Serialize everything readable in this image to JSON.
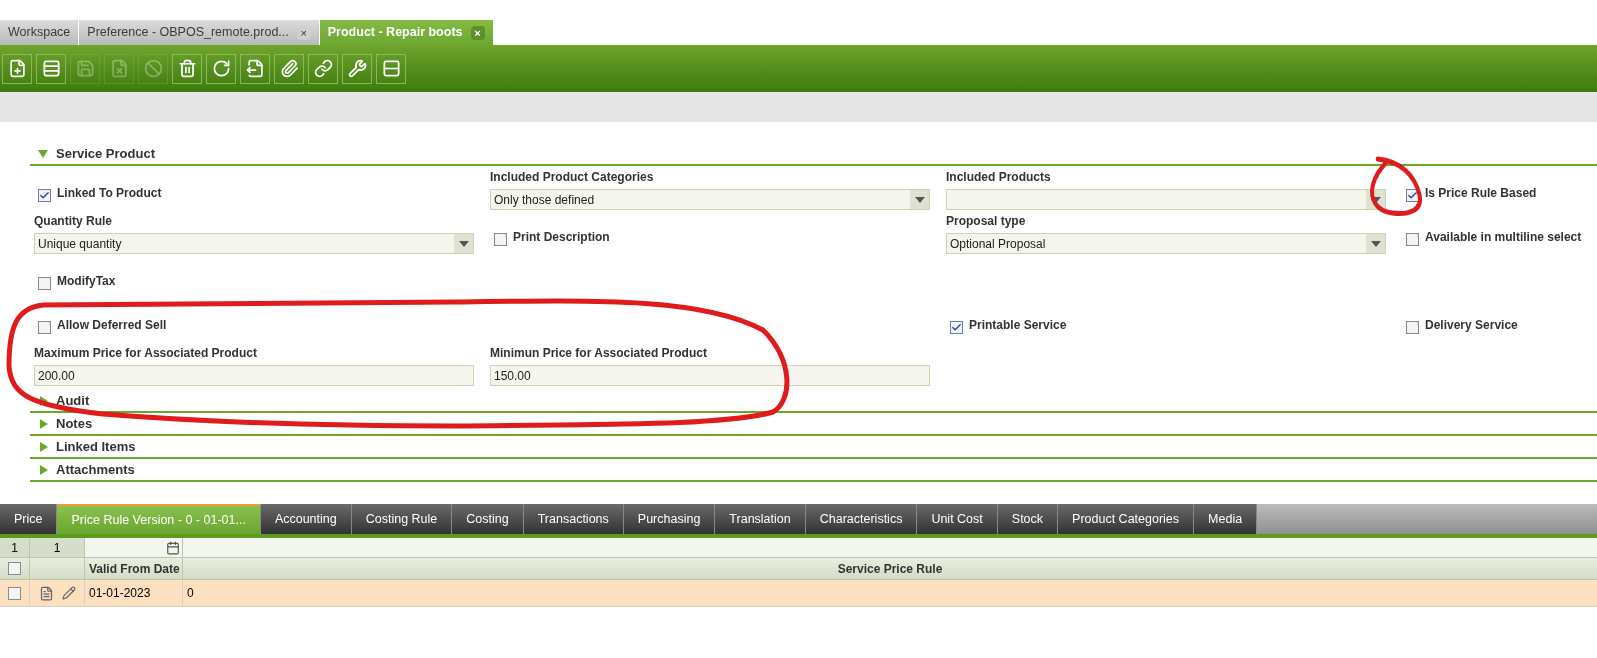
{
  "doc_tabs": [
    {
      "label": "Workspace",
      "selected": false,
      "closable": false
    },
    {
      "label": "Preference - OBPOS_remote.prod...",
      "selected": false,
      "closable": true
    },
    {
      "label": "Product - Repair boots",
      "selected": true,
      "closable": true
    }
  ],
  "close_glyph": "×",
  "toolbar": [
    {
      "kind": "new",
      "disabled": false
    },
    {
      "kind": "new_grid",
      "disabled": false
    },
    {
      "kind": "save",
      "disabled": true
    },
    {
      "kind": "save_close",
      "disabled": true
    },
    {
      "kind": "cancel",
      "disabled": true
    },
    {
      "kind": "delete",
      "disabled": false
    },
    {
      "kind": "refresh",
      "disabled": false
    },
    {
      "kind": "export",
      "disabled": false
    },
    {
      "kind": "attach",
      "disabled": false
    },
    {
      "kind": "link",
      "disabled": false
    },
    {
      "kind": "tools",
      "disabled": false
    },
    {
      "kind": "layout",
      "disabled": false
    }
  ],
  "section": {
    "title": "Service Product",
    "expanded": true,
    "rows": [
      [
        {
          "kind": "checkbox",
          "label": "Linked To Product",
          "checked": true
        },
        {
          "kind": "select",
          "label": "Included Product Categories",
          "value": "Only those defined"
        },
        {
          "kind": "select",
          "label": "Included Products"
        },
        {
          "kind": "checkbox",
          "label": "Is Price Rule Based",
          "checked": true
        }
      ],
      [
        {
          "kind": "select",
          "label": "Quantity Rule",
          "value": "Unique quantity"
        },
        {
          "kind": "checkbox",
          "label": "Print Description",
          "checked": false
        },
        {
          "kind": "select",
          "label": "Proposal type",
          "value": "Optional Proposal"
        },
        {
          "kind": "checkbox",
          "label": "Available in multiline select",
          "checked": false
        }
      ],
      [
        {
          "kind": "checkbox",
          "label": "ModifyTax",
          "checked": false
        },
        {
          "kind": "blank"
        },
        {
          "kind": "blank"
        },
        {
          "kind": "blank"
        }
      ],
      [
        {
          "kind": "checkbox",
          "label": "Allow Deferred Sell",
          "checked": false
        },
        {
          "kind": "blank"
        },
        {
          "kind": "checkbox",
          "label": "Printable Service",
          "checked": true
        },
        {
          "kind": "checkbox",
          "label": "Delivery Service",
          "checked": false
        }
      ],
      [
        {
          "kind": "text",
          "label": "Maximum Price for Associated Product",
          "value": "200.00"
        },
        {
          "kind": "text",
          "label": "Minimun Price for Associated Product",
          "value": "150.00"
        },
        {
          "kind": "blank"
        },
        {
          "kind": "blank"
        }
      ]
    ]
  },
  "collapsed_sections": [
    {
      "title": "Audit",
      "expanded": false
    },
    {
      "title": "Notes",
      "expanded": false
    },
    {
      "title": "Linked Items",
      "expanded": false
    },
    {
      "title": "Attachments",
      "expanded": false
    }
  ],
  "sub_tabs": [
    {
      "label": "Price",
      "selected": false
    },
    {
      "label": "Price Rule Version - 0 - 01-01...",
      "selected": true
    },
    {
      "label": "Accounting",
      "selected": false
    },
    {
      "label": "Costing Rule",
      "selected": false
    },
    {
      "label": "Costing",
      "selected": false
    },
    {
      "label": "Transactions",
      "selected": false
    },
    {
      "label": "Purchasing",
      "selected": false
    },
    {
      "label": "Translation",
      "selected": false
    },
    {
      "label": "Characteristics",
      "selected": false
    },
    {
      "label": "Unit Cost",
      "selected": false
    },
    {
      "label": "Stock",
      "selected": false
    },
    {
      "label": "Product Categories",
      "selected": false
    },
    {
      "label": "Media",
      "selected": false
    }
  ],
  "grid": {
    "counts": [
      "1",
      "1"
    ],
    "all_checked": false,
    "columns": [
      "Valid From Date",
      "Service Price Rule"
    ],
    "rows": [
      {
        "checked": false,
        "selected": true,
        "cells": [
          "01-01-2023",
          "0"
        ]
      }
    ]
  }
}
